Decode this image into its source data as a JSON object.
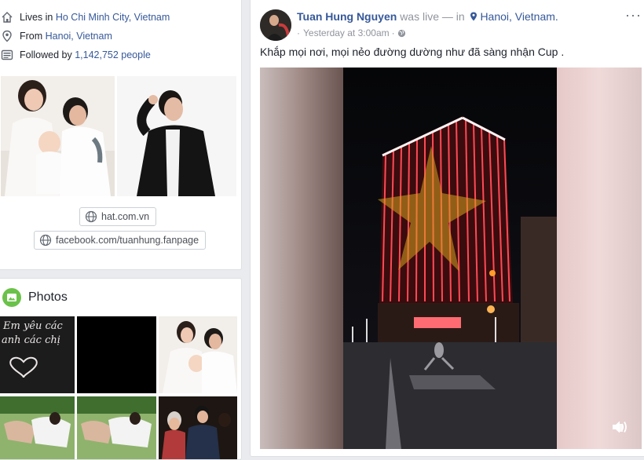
{
  "intro": {
    "lives_prefix": "Lives in ",
    "lives_link": "Ho Chi Minh City, Vietnam",
    "from_prefix": "From ",
    "from_link": "Hanoi, Vietnam",
    "followed_prefix": "Followed by ",
    "followed_link": "1,142,752 people",
    "websites": [
      "hat.com.vn",
      "facebook.com/tuanhung.fanpage"
    ]
  },
  "photos": {
    "title": "Photos",
    "handwriting": [
      "Em yêu các",
      "anh các chị"
    ]
  },
  "post": {
    "author": "Tuan Hung Nguyen",
    "status": "was live — in",
    "place": "Hanoi, Vietnam.",
    "time": "Yesterday at 3:00am",
    "sep": "·",
    "text": "Khắp mọi nơi, mọi nẻo đường dường như đã sàng nhận Cup .",
    "more": "···"
  },
  "colors": {
    "link": "#365899",
    "muted": "#90949c",
    "bg": "#e9ebee",
    "photos_icon": "#6bc24a"
  },
  "icons": [
    "home-icon",
    "location-pin-icon",
    "followers-icon",
    "globe-icon",
    "photos-icon",
    "globe-small-icon",
    "pin-icon",
    "volume-icon"
  ]
}
